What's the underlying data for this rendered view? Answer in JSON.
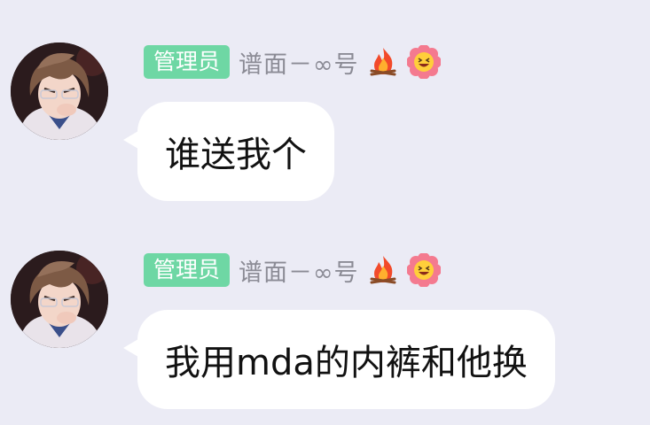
{
  "messages": [
    {
      "role": "管理员",
      "nickname": "谱面－∞号",
      "text": "谁送我个"
    },
    {
      "role": "管理员",
      "nickname": "谱面－∞号",
      "text": "我用mda的内裤和他换"
    }
  ],
  "badges": [
    "fire-emoji-icon",
    "laughing-flower-emoji-icon"
  ],
  "colors": {
    "background": "#ebebf5",
    "role_badge": "#6ed7a4",
    "nickname": "#8b8b95",
    "bubble": "#ffffff",
    "text": "#111111"
  }
}
